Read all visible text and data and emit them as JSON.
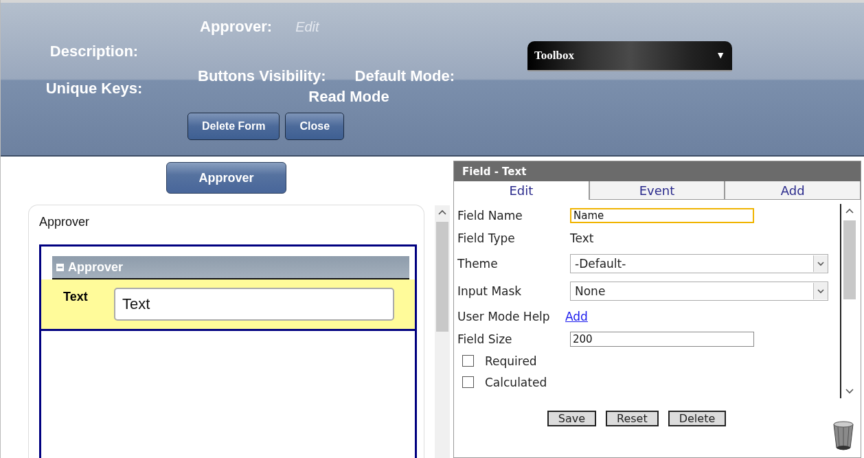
{
  "header": {
    "approver": {
      "label": "Approver:",
      "value": "Edit"
    },
    "description_label": "Description:",
    "unique_keys_label": "Unique Keys:",
    "buttons_visibility_label": "Buttons Visibility:",
    "default_mode": {
      "label": "Default Mode:",
      "value": "Read Mode"
    },
    "buttons": [
      "Delete Form",
      "Close"
    ],
    "toolbox": {
      "label": "Toolbox",
      "arrow": "▼"
    }
  },
  "left": {
    "form_button": "Approver",
    "card_title": "Approver",
    "section": {
      "title": "Approver",
      "expanded": true,
      "fields": [
        {
          "label": "Text",
          "value": "Text"
        }
      ]
    }
  },
  "right": {
    "title": "Field - Text",
    "tabs": [
      {
        "label": "Edit",
        "selected": true
      },
      {
        "label": "Event",
        "selected": false
      },
      {
        "label": "Add",
        "selected": false
      }
    ],
    "rows": [
      {
        "kind": "input",
        "label": "Field Name",
        "value": "Name",
        "focused": true
      },
      {
        "kind": "static",
        "label": "Field Type",
        "value": "Text"
      },
      {
        "kind": "select",
        "label": "Theme",
        "value": "-Default-"
      },
      {
        "kind": "select",
        "label": "Input Mask",
        "value": "None"
      },
      {
        "kind": "link",
        "label": "User Mode Help",
        "value": "Add"
      },
      {
        "kind": "input",
        "label": "Field Size",
        "value": "200",
        "focused": false
      },
      {
        "kind": "checkbox",
        "label": "Required",
        "checked": false
      },
      {
        "kind": "checkbox",
        "label": "Calculated",
        "checked": false
      }
    ],
    "buttons": [
      "Save",
      "Reset",
      "Delete"
    ]
  }
}
